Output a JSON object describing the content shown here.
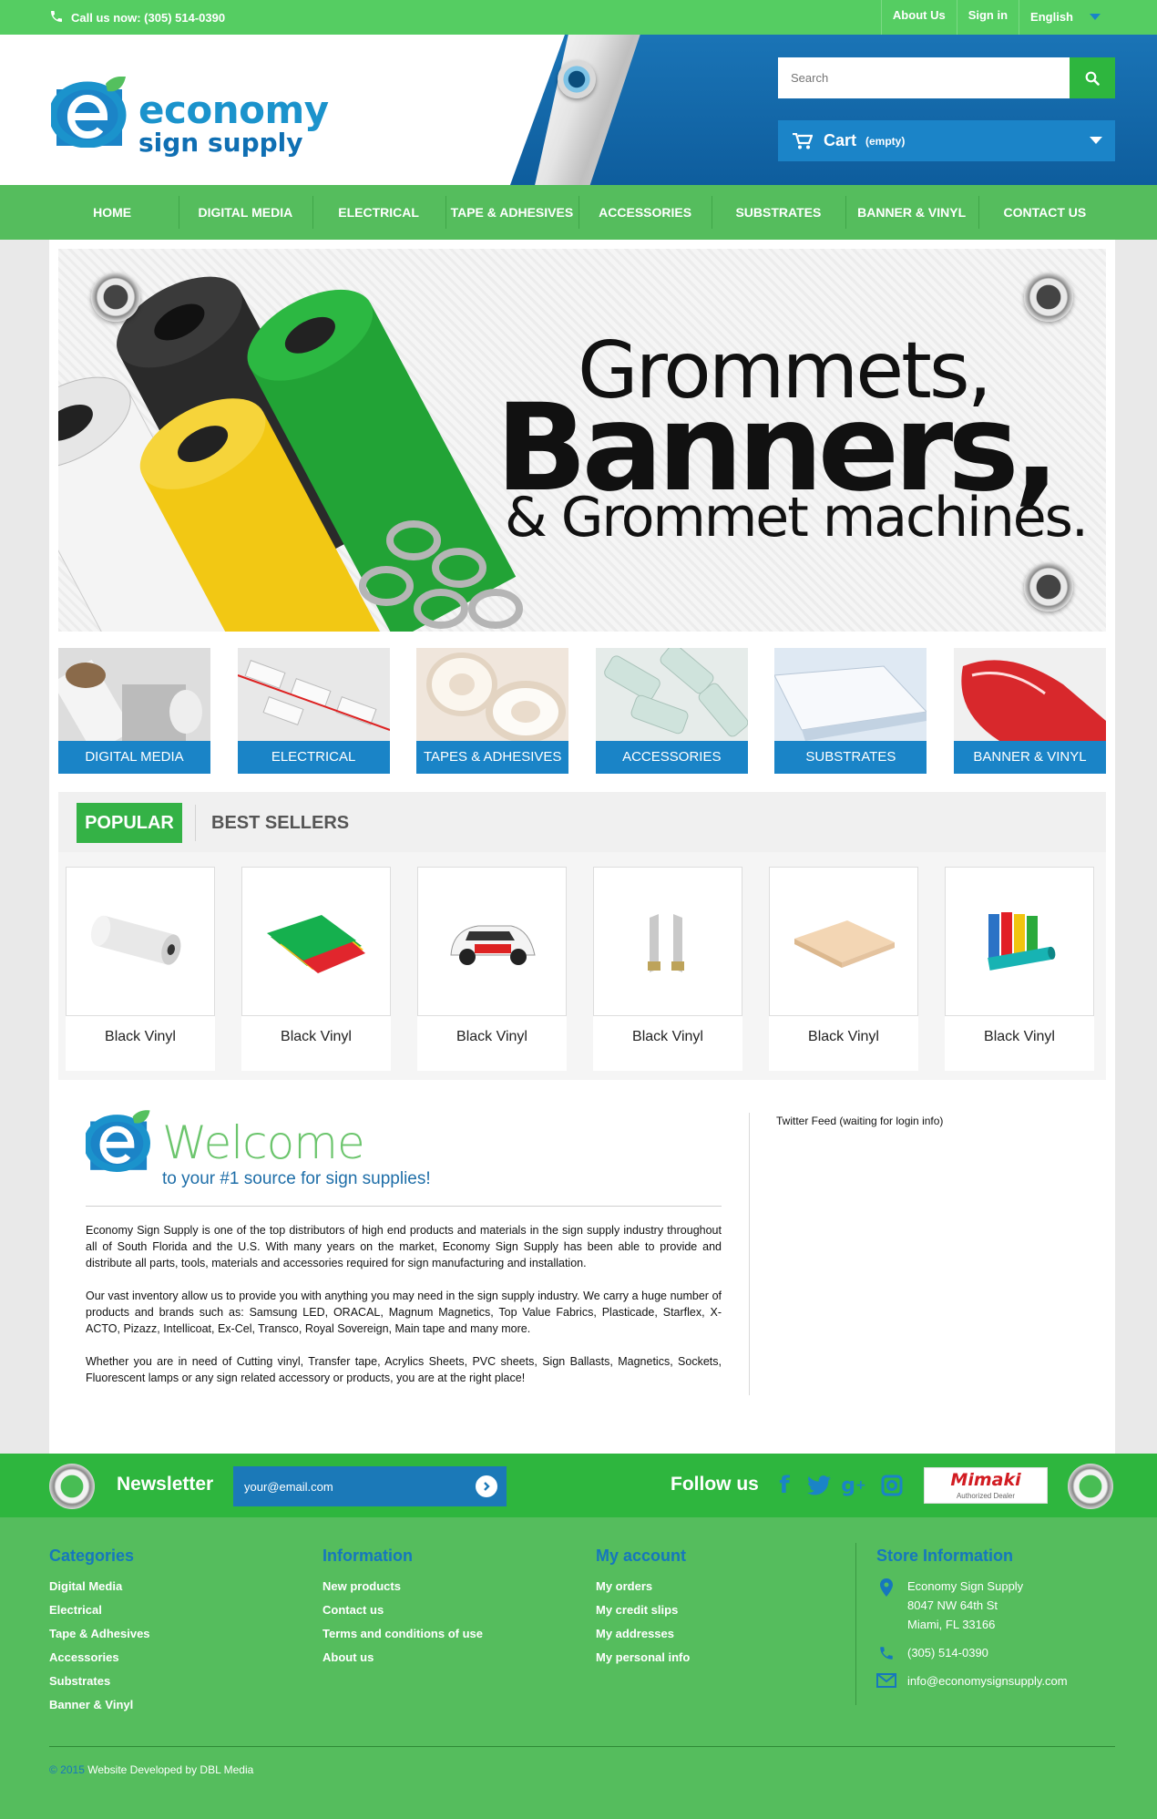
{
  "topbar": {
    "phone": "Call us now: (305) 514-0390",
    "links": [
      "About Us",
      "Sign in"
    ],
    "language": "English"
  },
  "header": {
    "logo_line1": "economy",
    "logo_line2": "sign supply",
    "search_placeholder": "Search",
    "cart_label": "Cart",
    "cart_status": "(empty)"
  },
  "nav": [
    "HOME",
    "DIGITAL MEDIA",
    "ELECTRICAL",
    "TAPE & ADHESIVES",
    "ACCESSORIES",
    "SUBSTRATES",
    "BANNER & VINYL",
    "CONTACT US"
  ],
  "banner": {
    "line1": "Grommets,",
    "line2": "Banners,",
    "line3": "& Grommet machines."
  },
  "categories": [
    "Digital Media",
    "Electrical",
    "Tapes & Adhesives",
    "Accessories",
    "Substrates",
    "Banner & Vinyl"
  ],
  "tabs": {
    "active": "POPULAR",
    "other": "BEST SELLERS"
  },
  "products": [
    "Black Vinyl",
    "Black Vinyl",
    "Black Vinyl",
    "Black Vinyl",
    "Black Vinyl",
    "Black Vinyl"
  ],
  "welcome": {
    "title": "Welcome",
    "subtitle": "to your #1 source for sign supplies!",
    "p1": "Economy Sign Supply is one of the top distributors of high end products and materials in the sign supply industry throughout all of South Florida and the U.S. With many years on the market, Economy Sign Supply has been able to provide and distribute all parts, tools, materials and accessories required for sign manufacturing and installation.",
    "p2": "Our vast inventory allow us to provide you with anything you may need in the sign supply industry. We carry a huge number of products and brands such as: Samsung LED, ORACAL, Magnum Magnetics, Top Value Fabrics, Plasticade, Starflex, X-ACTO, Pizazz, Intellicoat, Ex-Cel, Transco, Royal Sovereign, Main tape and many more.",
    "p3": "Whether you are in need of Cutting vinyl, Transfer tape, Acrylics Sheets, PVC sheets, Sign Ballasts, Magnetics, Sockets, Fluorescent lamps or any sign related accessory or products, you are at the right place!"
  },
  "twitter": "Twitter Feed (waiting for login info)",
  "newsletter": {
    "label": "Newsletter",
    "email_value": "your@email.com",
    "follow_label": "Follow us",
    "social_icons": [
      "facebook-icon",
      "twitter-icon",
      "google-plus-icon",
      "instagram-icon"
    ],
    "badge_brand": "Mimaki",
    "badge_sub": "Authorized Dealer"
  },
  "footer": {
    "categories_title": "Categories",
    "categories": [
      "Digital Media",
      "Electrical",
      "Tape & Adhesives",
      "Accessories",
      "Substrates",
      "Banner & Vinyl"
    ],
    "information_title": "Information",
    "information": [
      "New products",
      "Contact us",
      "Terms and conditions of use",
      "About us"
    ],
    "account_title": "My account",
    "account": [
      "My orders",
      "My credit slips",
      "My addresses",
      "My personal info"
    ],
    "store_title": "Store Information",
    "store_name": "Economy Sign Supply",
    "store_street": "8047 NW 64th St",
    "store_city": "Miami, FL 33166",
    "store_phone": "(305) 514-0390",
    "store_email": "info@economysignsupply.com",
    "copyright_year": "© 2015",
    "copyright_text": "Website Developed by DBL Media"
  },
  "colors": {
    "green": "#55cd62",
    "dark_green": "#2eb63e",
    "blue": "#1a84c7",
    "footer_blue": "#1677bd"
  }
}
